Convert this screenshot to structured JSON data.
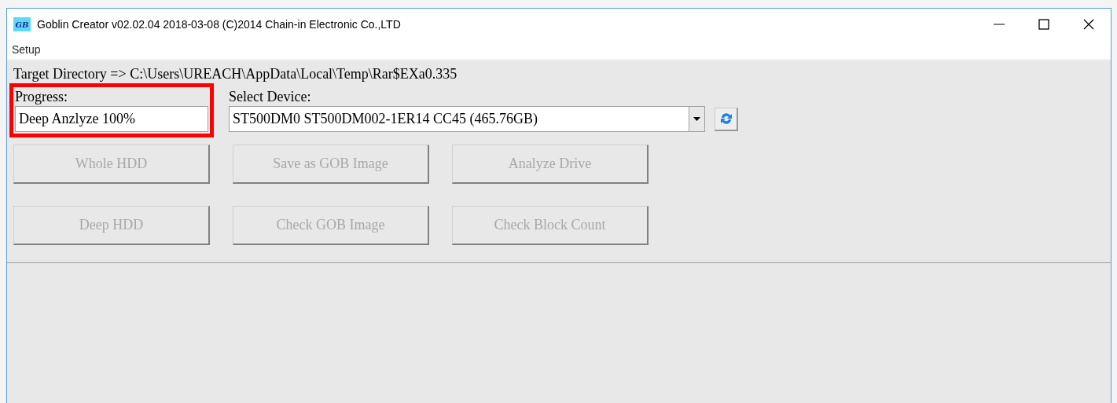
{
  "window": {
    "logo_text": "GB",
    "title": "Goblin Creator v02.02.04 2018-03-08  (C)2014 Chain-in Electronic Co.,LTD"
  },
  "menu": [
    {
      "label": "Setup"
    }
  ],
  "target_directory": "Target Directory => C:\\Users\\UREACH\\AppData\\Local\\Temp\\Rar$EXa0.335",
  "progress": {
    "label": "Progress:",
    "value": "Deep Anzlyze 100%",
    "highlighted": true
  },
  "device": {
    "label": "Select Device:",
    "value": "ST500DM0 ST500DM002-1ER14 CC45 (465.76GB)"
  },
  "buttons": [
    {
      "label": "Whole HDD",
      "disabled": true
    },
    {
      "label": "Save as GOB Image",
      "disabled": true
    },
    {
      "label": "Analyze Drive",
      "disabled": true
    },
    {
      "label": "Deep HDD",
      "disabled": true
    },
    {
      "label": "Check GOB Image",
      "disabled": true
    },
    {
      "label": "Check Block Count",
      "disabled": true
    }
  ]
}
